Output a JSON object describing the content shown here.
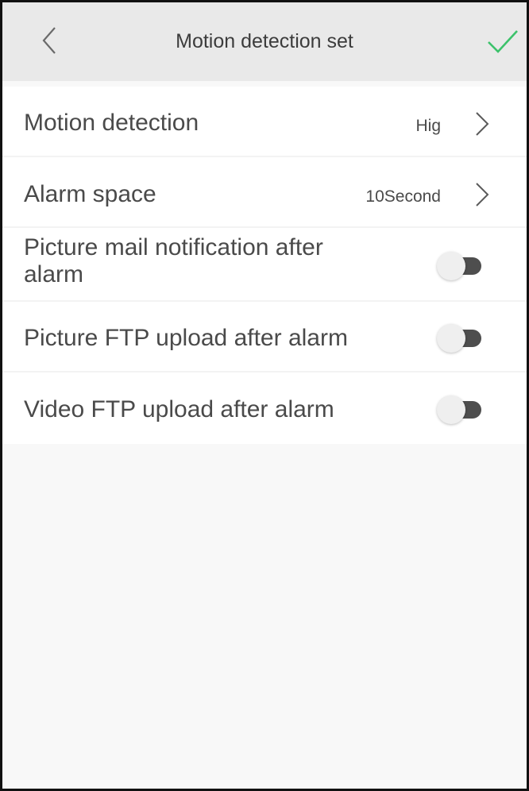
{
  "header": {
    "title": "Motion detection set",
    "back_icon": "chevron-left-icon",
    "confirm_icon": "checkmark-icon",
    "confirm_color": "#3cc26b"
  },
  "settings": [
    {
      "label": "Motion detection",
      "value": "Hig",
      "type": "select"
    },
    {
      "label": "Alarm space",
      "value": "10Second",
      "type": "select"
    },
    {
      "label": "Picture mail notification after alarm",
      "label_line1": "Picture mail notification after",
      "label_line2": "alarm",
      "type": "toggle",
      "on": false
    },
    {
      "label": "Picture FTP upload after alarm",
      "type": "toggle",
      "on": false
    },
    {
      "label": "Video FTP upload after alarm",
      "type": "toggle",
      "on": false
    }
  ]
}
